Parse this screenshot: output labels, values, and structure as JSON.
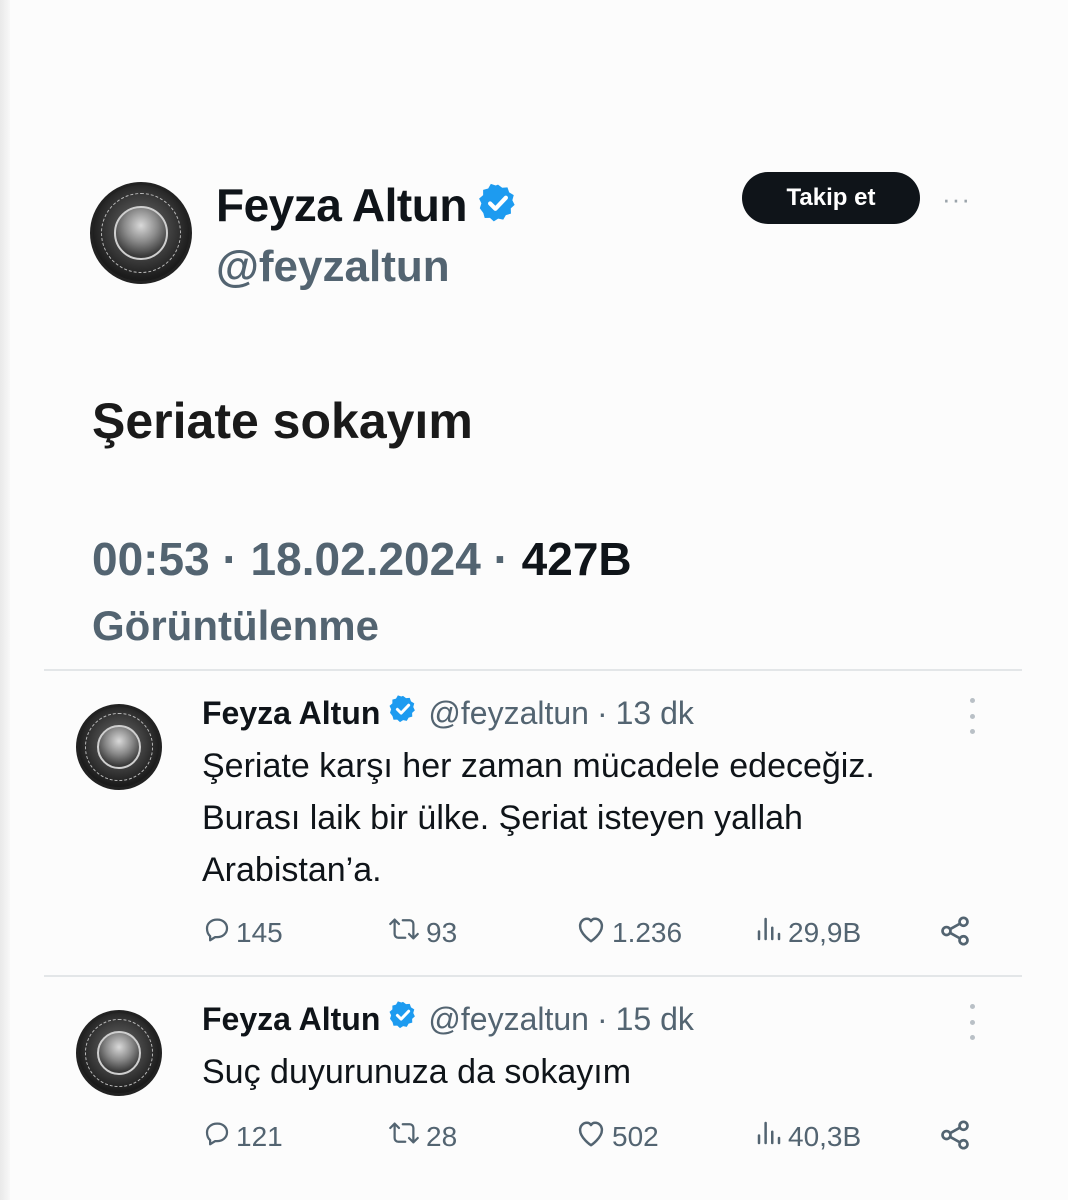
{
  "main_tweet": {
    "author_name": "Feyza Altun",
    "handle": "@feyzaltun",
    "follow_label": "Takip et",
    "more_label": "···",
    "text": "Şeriate sokayım",
    "time": "00:53",
    "date": "18.02.2024",
    "separator": " · ",
    "views_count": "427B",
    "views_label": "Görüntülenme"
  },
  "replies": [
    {
      "author_name": "Feyza Altun",
      "handle": "@feyzaltun",
      "separator": "·",
      "time_ago": "13 dk",
      "text_lines": [
        "Şeriate karşı her zaman mücadele edeceğiz.",
        "Burası laik bir ülke. Şeriat isteyen yallah",
        "Arabistan’a."
      ],
      "actions": {
        "replies": "145",
        "reposts": "93",
        "likes": "1.236",
        "views": "29,9B"
      }
    },
    {
      "author_name": "Feyza Altun",
      "handle": "@feyzaltun",
      "separator": "·",
      "time_ago": "15 dk",
      "text_lines": [
        "Suç duyurunuza da sokayım"
      ],
      "actions": {
        "replies": "121",
        "reposts": "28",
        "likes": "502",
        "views": "40,3B"
      }
    }
  ],
  "icons": {
    "verified": "verified-badge-icon",
    "reply": "reply-bubble-icon",
    "repost": "repost-arrows-icon",
    "like": "heart-icon",
    "views": "bar-chart-icon",
    "share": "share-icon",
    "more": "more-dots-icon"
  },
  "colors": {
    "verified_blue": "#1d9bf0",
    "text_primary": "#0f1419",
    "text_secondary": "#536471",
    "follow_button_bg": "#0f1419",
    "divider": "#e3e6e8"
  }
}
